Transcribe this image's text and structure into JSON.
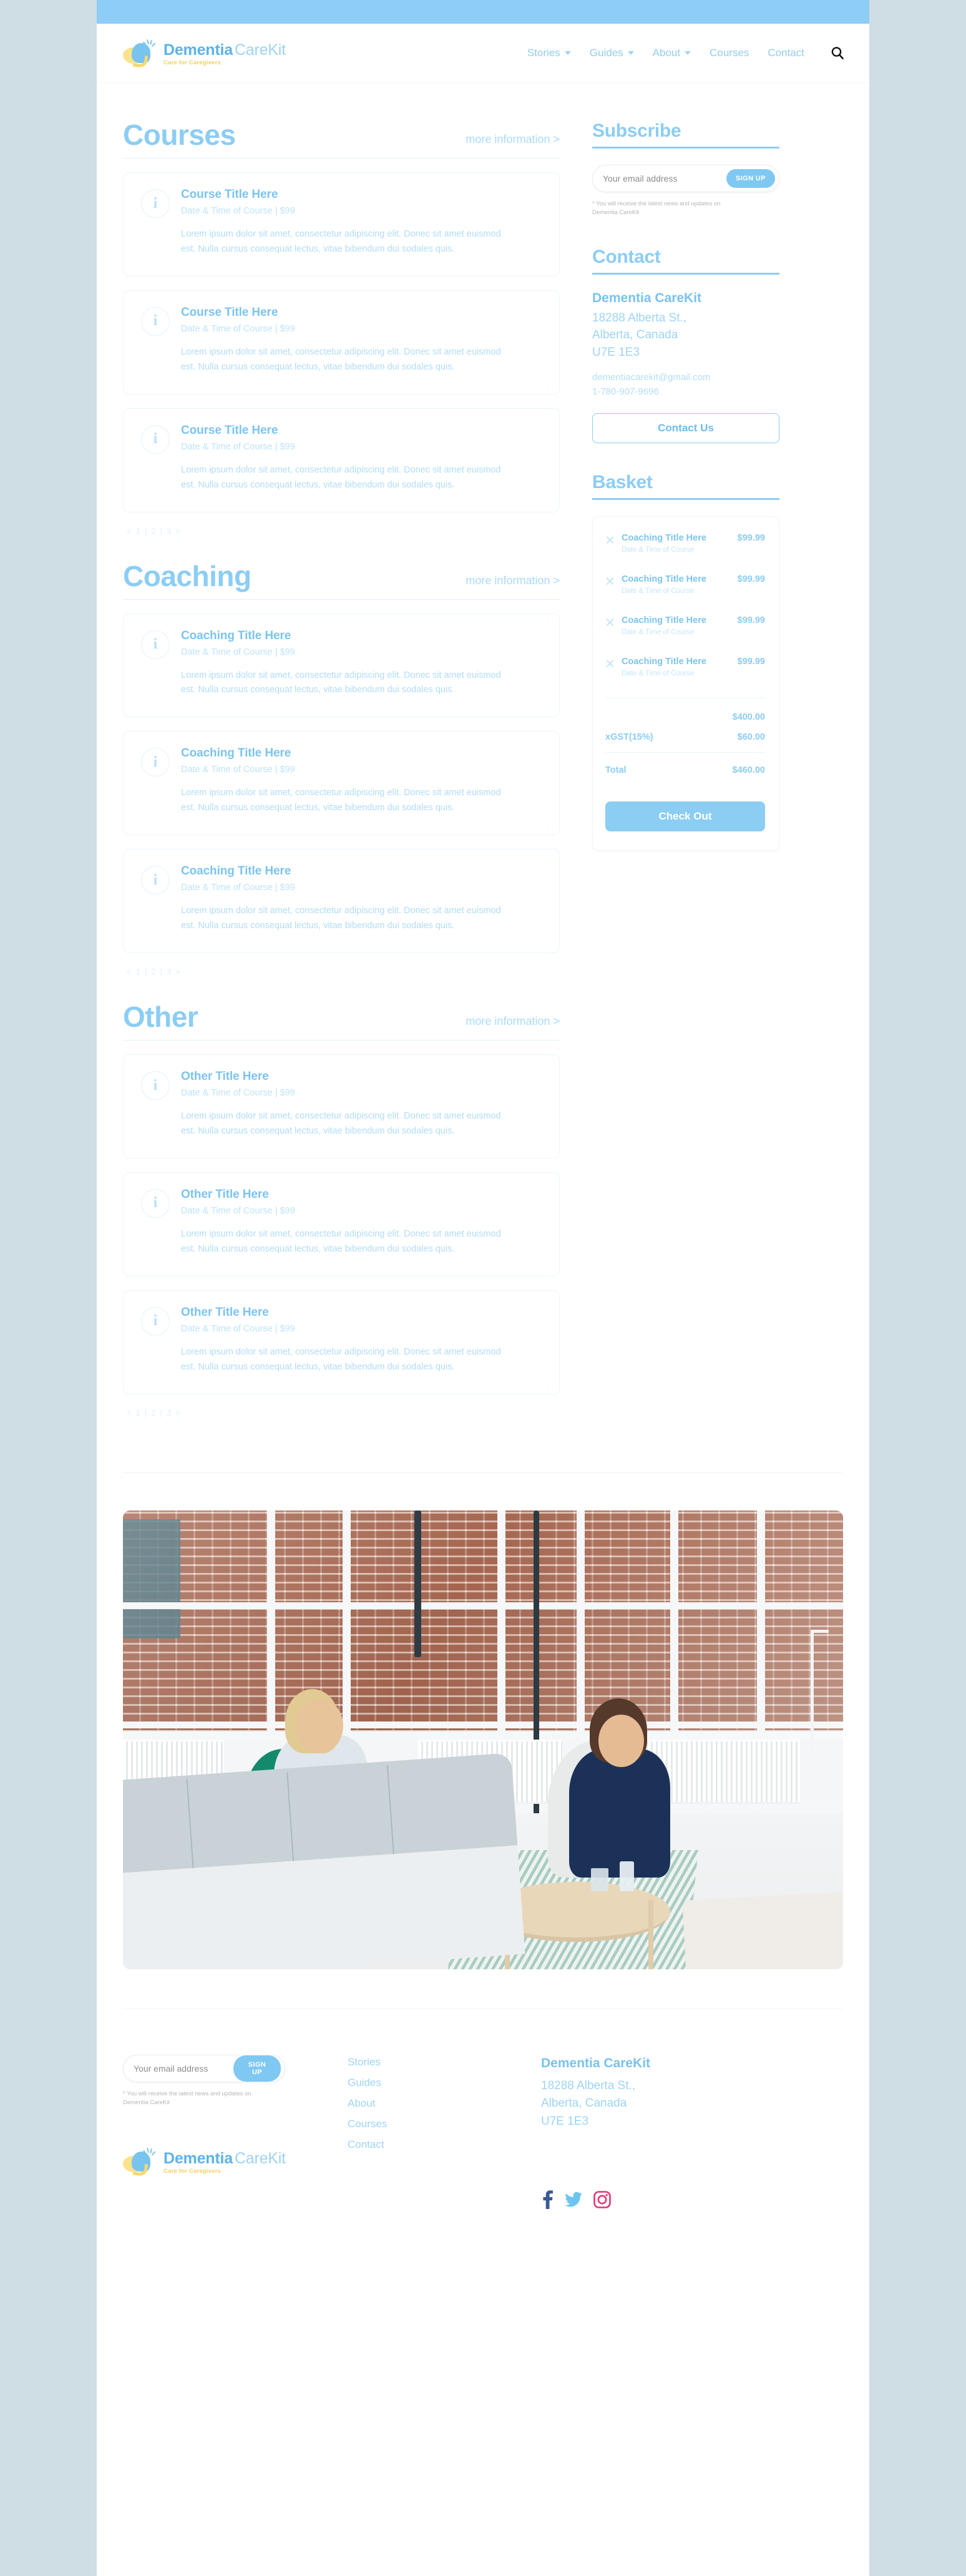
{
  "brand": {
    "name_bold": "Dementia",
    "name_light": "CareKit",
    "tagline": "Care for Caregivers",
    "accent": "#8ccdf4",
    "accent_dark": "#5bb3ea",
    "accent_yellow": "#fbe38d",
    "topbar_color": "#8ecdf5",
    "page_bg": "#cfdde4"
  },
  "nav": {
    "items": [
      {
        "label": "Stories",
        "has_dropdown": true
      },
      {
        "label": "Guides",
        "has_dropdown": true
      },
      {
        "label": "About",
        "has_dropdown": true
      },
      {
        "label": "Courses",
        "has_dropdown": false
      },
      {
        "label": "Contact",
        "has_dropdown": false
      }
    ],
    "search_icon": "search-icon"
  },
  "sections": [
    {
      "id": "courses",
      "title": "Courses",
      "more_label": "more information >",
      "cards": [
        {
          "title": "Course Title Here",
          "meta": "Date & Time of Course  |  $99",
          "desc": "Lorem ipsum dolor sit amet, consectetur adipiscing elit. Donec sit amet euismod est. Nulla cursus consequat lectus, vitae bibendum dui sodales quis."
        },
        {
          "title": "Course Title Here",
          "meta": "Date & Time of Course  |  $99",
          "desc": "Lorem ipsum dolor sit amet, consectetur adipiscing elit. Donec sit amet euismod est. Nulla cursus consequat lectus, vitae bibendum dui sodales quis."
        },
        {
          "title": "Course Title Here",
          "meta": "Date & Time of Course  |  $99",
          "desc": "Lorem ipsum dolor sit amet, consectetur adipiscing elit. Donec sit amet euismod est. Nulla cursus consequat lectus, vitae bibendum dui sodales quis."
        }
      ]
    },
    {
      "id": "coaching",
      "title": "Coaching",
      "more_label": "more information >",
      "cards": [
        {
          "title": "Coaching Title Here",
          "meta": "Date & Time of Course  |  $99",
          "desc": "Lorem ipsum dolor sit amet, consectetur adipiscing elit. Donec sit amet euismod est. Nulla cursus consequat lectus, vitae bibendum dui sodales quis."
        },
        {
          "title": "Coaching Title Here",
          "meta": "Date & Time of Course  |  $99",
          "desc": "Lorem ipsum dolor sit amet, consectetur adipiscing elit. Donec sit amet euismod est. Nulla cursus consequat lectus, vitae bibendum dui sodales quis."
        },
        {
          "title": "Coaching Title Here",
          "meta": "Date & Time of Course  |  $99",
          "desc": "Lorem ipsum dolor sit amet, consectetur adipiscing elit. Donec sit amet euismod est. Nulla cursus consequat lectus, vitae bibendum dui sodales quis."
        }
      ]
    },
    {
      "id": "other",
      "title": "Other",
      "more_label": "more information >",
      "cards": [
        {
          "title": "Other Title Here",
          "meta": "Date & Time of Course  |  $99",
          "desc": "Lorem ipsum dolor sit amet, consectetur adipiscing elit. Donec sit amet euismod est. Nulla cursus consequat lectus, vitae bibendum dui sodales quis."
        },
        {
          "title": "Other Title Here",
          "meta": "Date & Time of Course  |  $99",
          "desc": "Lorem ipsum dolor sit amet, consectetur adipiscing elit. Donec sit amet euismod est. Nulla cursus consequat lectus, vitae bibendum dui sodales quis."
        },
        {
          "title": "Other Title Here",
          "meta": "Date & Time of Course  |  $99",
          "desc": "Lorem ipsum dolor sit amet, consectetur adipiscing elit. Donec sit amet euismod est. Nulla cursus consequat lectus, vitae bibendum dui sodales quis."
        }
      ]
    }
  ],
  "pagination": {
    "prev": "<",
    "pages": [
      "1",
      "2",
      "3"
    ],
    "sep": "|",
    "next": ">"
  },
  "subscribe": {
    "title": "Subscribe",
    "placeholder": "Your email address",
    "value": "",
    "button": "SIGN UP",
    "disclaimer": "* You will receive the latest news and updates on Dementia CareKit"
  },
  "contact": {
    "title": "Contact",
    "org": "Dementia CareKit",
    "address_line1": "18288 Alberta St.,",
    "address_line2": "Alberta, Canada",
    "address_line3": "U7E 1E3",
    "email": "dementiacarekit@gmail.com",
    "phone": "1-780-907-9696",
    "button": "Contact Us"
  },
  "basket": {
    "title": "Basket",
    "items": [
      {
        "title": "Coaching Title Here",
        "date": "Date & Time of Course",
        "price": "$99.99",
        "remove_icon": "close-icon"
      },
      {
        "title": "Coaching Title Here",
        "date": "Date & Time of Course",
        "price": "$99.99",
        "remove_icon": "close-icon"
      },
      {
        "title": "Coaching Title Here",
        "date": "Date & Time of Course",
        "price": "$99.99",
        "remove_icon": "close-icon"
      },
      {
        "title": "Coaching Title Here",
        "date": "Date & Time of Course",
        "price": "$99.99",
        "remove_icon": "close-icon"
      }
    ],
    "subtotal_label": "",
    "subtotal_value": "$400.00",
    "tax_label": "xGST(15%)",
    "tax_value": "$60.00",
    "total_label": "Total",
    "total_value": "$460.00",
    "checkout_button": "Check Out"
  },
  "hero": {
    "alt": "two-women-in-meeting-photo"
  },
  "footer": {
    "subscribe": {
      "placeholder": "Your email address",
      "value": "",
      "button": "SIGN UP",
      "disclaimer": "* You will receive the latest news and updates on Dementia CareKit"
    },
    "links": [
      "Stories",
      "Guides",
      "About",
      "Courses",
      "Contact"
    ],
    "org": "Dementia CareKit",
    "address_line1": "18288 Alberta St.,",
    "address_line2": "Alberta, Canada",
    "address_line3": "U7E 1E3",
    "socials": [
      {
        "name": "facebook-icon",
        "color": "#3b5998"
      },
      {
        "name": "twitter-icon",
        "color": "#6ec4f0"
      },
      {
        "name": "instagram-icon",
        "color": "#e4366f"
      }
    ]
  }
}
